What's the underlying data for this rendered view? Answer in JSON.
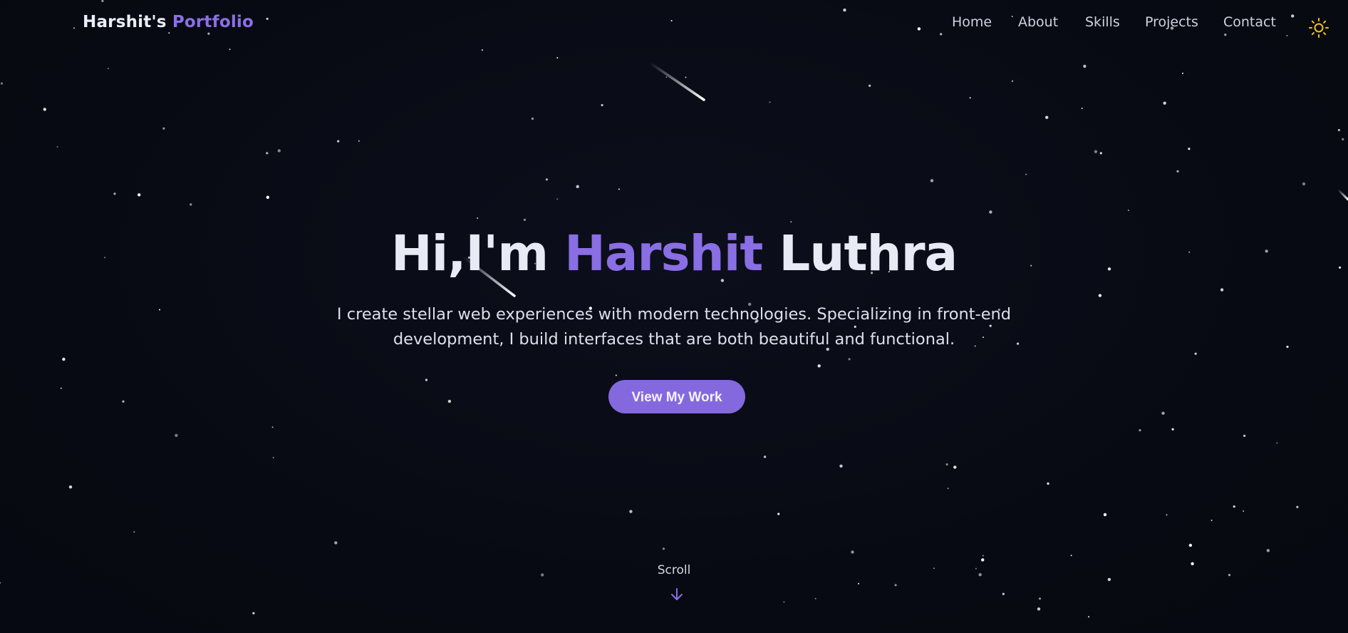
{
  "brand": {
    "name": "Harshit's",
    "accent": "Portfolio"
  },
  "nav": {
    "items": [
      {
        "label": "Home"
      },
      {
        "label": "About"
      },
      {
        "label": "Skills"
      },
      {
        "label": "Projects"
      },
      {
        "label": "Contact"
      }
    ],
    "theme_icon": "sun-icon"
  },
  "hero": {
    "greeting": "Hi,I'm",
    "first_name": "Harshit",
    "last_name": "Luthra",
    "subtitle_line1": "I create stellar web experiences with modern technologies. Specializing in front-end",
    "subtitle_line2": "development, I build interfaces that are both beautiful and functional.",
    "cta_label": "View My Work"
  },
  "scroll": {
    "label": "Scroll",
    "icon": "arrow-down-icon"
  },
  "colors": {
    "background": "#080a13",
    "accent": "#8a6ee3",
    "text": "#e8eaf4",
    "sun": "#f2c21b"
  }
}
